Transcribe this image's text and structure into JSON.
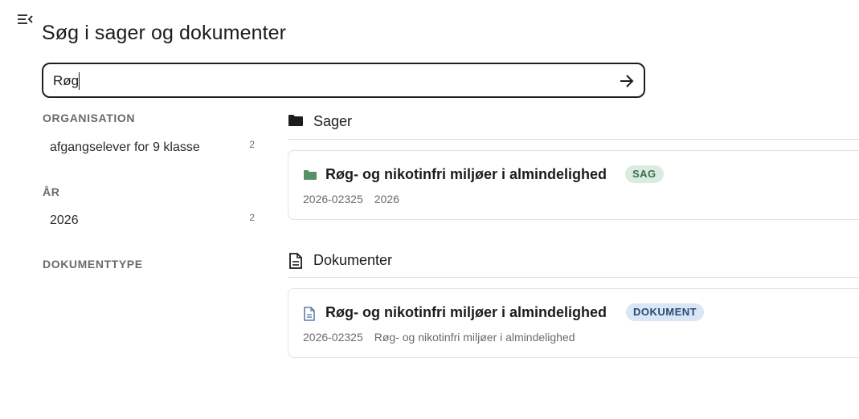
{
  "page": {
    "title": "Søg i sager og dokumenter"
  },
  "search": {
    "value": "Røg",
    "submit_icon": "arrow-right-icon"
  },
  "sidebar": {
    "toggle_icon": "menu-collapse-icon",
    "facets": [
      {
        "heading": "ORGANISATION",
        "items": [
          {
            "label": "afgangselever for 9 klasse",
            "count": "2"
          }
        ]
      },
      {
        "heading": "ÅR",
        "items": [
          {
            "label": "2026",
            "count": "2"
          }
        ]
      },
      {
        "heading": "DOKUMENTTYPE",
        "items": []
      }
    ]
  },
  "sections": {
    "cases": {
      "title": "Sager",
      "icon": "folder-icon",
      "results": [
        {
          "title": "Røg- og nikotinfri miljøer i almindelighed",
          "badge": "SAG",
          "icon": "folder-icon",
          "icon_color": "#5a9068",
          "case_number": "2026-02325",
          "year": "2026"
        }
      ]
    },
    "documents": {
      "title": "Dokumenter",
      "icon": "document-icon",
      "results": [
        {
          "title": "Røg- og nikotinfri miljøer i almindelighed",
          "badge": "DOKUMENT",
          "icon": "document-icon",
          "icon_color": "#5b7fa8",
          "case_number": "2026-02325",
          "case_title": "Røg- og nikotinfri miljøer i almindelighed"
        }
      ]
    }
  },
  "colors": {
    "text": "#1c1c1c",
    "muted": "#6a6a6a",
    "sag_badge_bg": "#d9ecdf",
    "doc_badge_bg": "#d8e6f6",
    "divider": "#dcdcdc"
  }
}
